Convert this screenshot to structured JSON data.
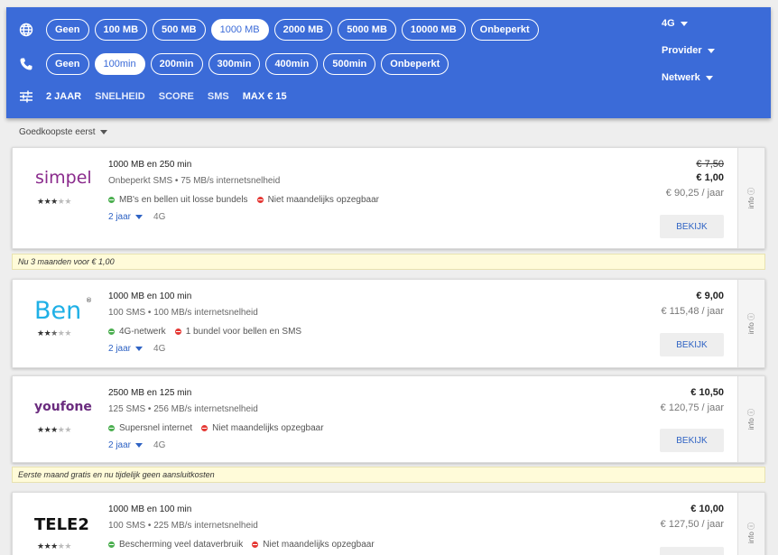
{
  "filters": {
    "data_chips": [
      "Geen",
      "100 MB",
      "500 MB",
      "1000 MB",
      "2000 MB",
      "5000 MB",
      "10000 MB",
      "Onbeperkt"
    ],
    "data_active": "1000 MB",
    "minutes_chips": [
      "Geen",
      "100min",
      "200min",
      "300min",
      "400min",
      "500min",
      "Onbeperkt"
    ],
    "minutes_active": "100min",
    "options": [
      "2 JAAR",
      "SNELHEID",
      "SCORE",
      "SMS",
      "MAX € 15"
    ],
    "dropdowns": [
      "4G",
      "Provider",
      "Netwerk"
    ],
    "accent_color": "#3b6bd8"
  },
  "sort": {
    "label": "Goedkoopste eerst"
  },
  "offers": [
    {
      "provider": "simpel",
      "rating": 3,
      "title": "1000 MB en 250 min",
      "subtitle": "Onbeperkt SMS • 75 MB/s internetsnelheid",
      "pro": "MB's en bellen uit losse bundels",
      "con": "Niet maandelijks opzegbaar",
      "duration": "2 jaar",
      "network": "4G",
      "old_price": "€ 7,50",
      "price": "€ 1,00",
      "yearly": "€ 90,25 / jaar",
      "button": "BEKIJK",
      "info": "info ⓘ",
      "promo": "Nu 3 maanden voor € 1,00"
    },
    {
      "provider": "Ben",
      "rating": 2.5,
      "title": "1000 MB en 100 min",
      "subtitle": "100 SMS • 100 MB/s internetsnelheid",
      "pro": "4G-netwerk",
      "con": "1 bundel voor bellen en SMS",
      "duration": "2 jaar",
      "network": "4G",
      "price": "€ 9,00",
      "yearly": "€ 115,48 / jaar",
      "button": "BEKIJK",
      "info": "info ⓘ"
    },
    {
      "provider": "youfone",
      "rating": 3,
      "title": "2500 MB en 125 min",
      "subtitle": "125 SMS • 256 MB/s internetsnelheid",
      "pro": "Supersnel internet",
      "con": "Niet maandelijks opzegbaar",
      "duration": "2 jaar",
      "network": "4G",
      "price": "€ 10,50",
      "yearly": "€ 120,75 / jaar",
      "button": "BEKIJK",
      "info": "info ⓘ",
      "promo": "Eerste maand gratis en nu tijdelijk geen aansluitkosten"
    },
    {
      "provider": "TELE2",
      "rating": 3,
      "title": "1000 MB en 100 min",
      "subtitle": "100 SMS • 225 MB/s internetsnelheid",
      "pro": "Bescherming veel dataverbruik",
      "con": "Niet maandelijks opzegbaar",
      "price": "€ 10,00",
      "yearly": "€ 127,50 / jaar",
      "button": "BEKIJK",
      "info": "info ⓘ"
    }
  ]
}
